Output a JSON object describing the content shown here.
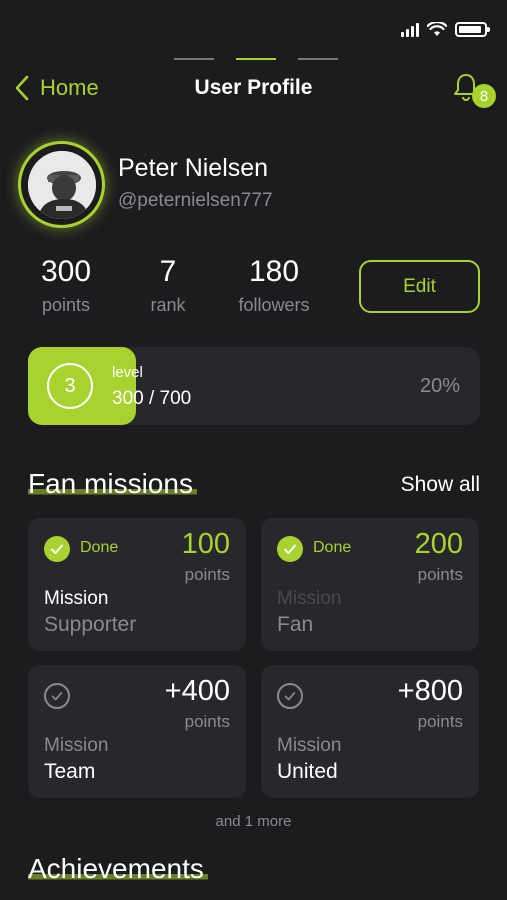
{
  "colors": {
    "accent": "#a8d22e",
    "background": "#1c1c1f",
    "card": "#28282c",
    "muted": "#8a8a8e"
  },
  "nav": {
    "back_label": "Home",
    "title": "User Profile",
    "notification_count": "8"
  },
  "profile": {
    "name": "Peter Nielsen",
    "handle": "@peternielsen777"
  },
  "stats": [
    {
      "value": "300",
      "label": "points"
    },
    {
      "value": "7",
      "label": "rank"
    },
    {
      "value": "180",
      "label": "followers"
    }
  ],
  "edit_label": "Edit",
  "level": {
    "number": "3",
    "label": "level",
    "progress": "300 / 700",
    "percent": "20%",
    "fill_fraction": 0.2
  },
  "missions_section": {
    "title": "Fan missions",
    "show_all": "Show all",
    "more": "and 1 more"
  },
  "missions": [
    {
      "status": "Done",
      "points": "100",
      "unit": "points",
      "label": "Mission",
      "name": "Supporter"
    },
    {
      "status": "Done",
      "points": "200",
      "unit": "points",
      "label": "Mission",
      "name": "Fan"
    },
    {
      "points": "+400",
      "unit": "points",
      "label": "Mission",
      "name": "Team"
    },
    {
      "points": "+800",
      "unit": "points",
      "label": "Mission",
      "name": "United"
    }
  ],
  "achievements": {
    "title": "Achievements"
  }
}
